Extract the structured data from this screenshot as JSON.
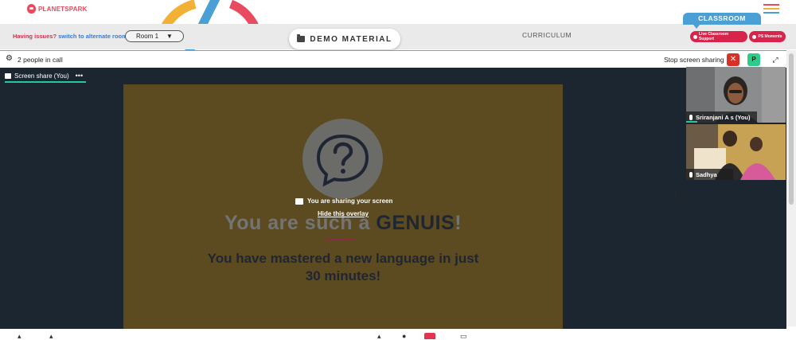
{
  "brand": {
    "name": "PLANETSPARK",
    "colors": {
      "brand_red": "#e84a5f",
      "classroom_blue": "#4a9fd5",
      "pill_red": "#d6244a",
      "stage_bg": "#1c2631",
      "slide_bg": "#5c4a21",
      "accent_green": "#26c6a0"
    }
  },
  "header": {
    "menu_icon": "hamburger-menu-icon",
    "menu_colors": [
      "#e84a5f",
      "#f2b134",
      "#4a9fd5"
    ]
  },
  "subbar": {
    "issues_label": "Having issues?",
    "alternate_room_link": "switch to alternate room",
    "room_select": {
      "selected": "Room 1",
      "icon": "caret-down-icon"
    },
    "demo_material_label": "DEMO MATERIAL",
    "curriculum_label": "CURRICULUM",
    "classroom_tab": "CLASSROOM",
    "live_support_label": "Live Classroom Support",
    "moments_label": "PS Moments"
  },
  "callbar": {
    "people_count_label": "2 people in call",
    "stop_sharing_label": "Stop screen sharing",
    "stop_icon": "✕",
    "p_label": "P",
    "expand_icon": "⤢"
  },
  "stage": {
    "share_tab_label": "Screen share (You)",
    "more_icon": "•••",
    "slide": {
      "sharing_notice": "You are sharing your screen",
      "hide_overlay_link": "Hide this overlay",
      "headline_prefix": "You are such a ",
      "headline_emphasis": "GENUIS",
      "headline_suffix": "!",
      "message": "You have mastered a new language in just 30 minutes!"
    }
  },
  "participants": [
    {
      "name": "Sriranjani A s (You)",
      "speaking": true
    },
    {
      "name": "Sadhya",
      "speaking": false
    }
  ]
}
